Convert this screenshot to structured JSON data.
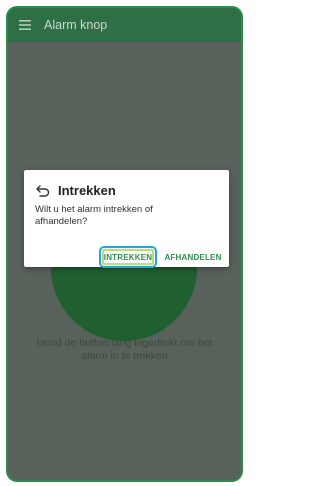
{
  "app": {
    "title": "Alarm knop",
    "menu_icon": "hamburger-menu-icon"
  },
  "main": {
    "hint_line1": "Houd de button lang ingedrukt om het",
    "hint_line2": "alarm in te trekken"
  },
  "dialog": {
    "icon": "undo-icon",
    "title": "Intrekken",
    "message_line1": "Wilt u het alarm intrekken of",
    "message_line2": "afhandelen?",
    "button_withdraw": "INTREKKEN",
    "button_handle": "AFHANDELEN"
  },
  "colors": {
    "frame_border": "#2e8b4a",
    "appbar": "#2e6f45",
    "overlay_background": "#58625b",
    "alarm_button": "#1f5f30",
    "dialog_button_text": "#2e8f4e",
    "focus_ring": "#27a6d6"
  }
}
